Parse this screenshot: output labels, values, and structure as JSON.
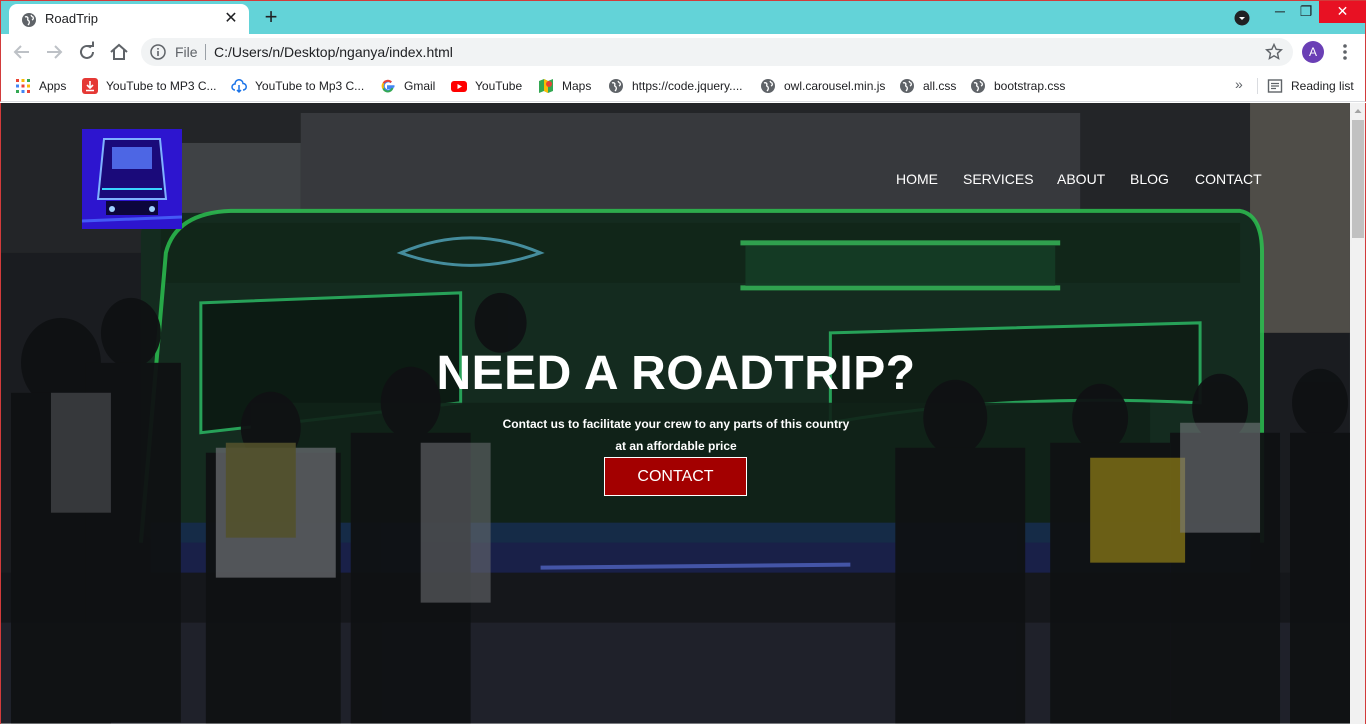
{
  "browser": {
    "tab": {
      "title": "RoadTrip"
    },
    "new_tab_symbol": "+",
    "omnibox": {
      "scheme_label": "File",
      "url": "C:/Users/n/Desktop/nganya/index.html"
    },
    "profile_initial": "A",
    "bookmarks": [
      {
        "label": "Apps",
        "icon": "apps-grid-icon"
      },
      {
        "label": "YouTube to MP3 C...",
        "icon": "download-icon"
      },
      {
        "label": "YouTube to Mp3 C...",
        "icon": "cloud-download-icon"
      },
      {
        "label": "Gmail",
        "icon": "google-icon"
      },
      {
        "label": "YouTube",
        "icon": "youtube-icon"
      },
      {
        "label": "Maps",
        "icon": "maps-icon"
      },
      {
        "label": "https://code.jquery....",
        "icon": "globe-icon"
      },
      {
        "label": "owl.carousel.min.js",
        "icon": "globe-icon"
      },
      {
        "label": "all.css",
        "icon": "globe-icon"
      },
      {
        "label": "bootstrap.css",
        "icon": "globe-icon"
      }
    ],
    "bookmarks_overflow": "»",
    "reading_list": "Reading list"
  },
  "page": {
    "nav": [
      "HOME",
      "SERVICES",
      "ABOUT",
      "BLOG",
      "CONTACT"
    ],
    "hero": {
      "headline": "NEED A ROADTRIP?",
      "subline_1": "Contact us to facilitate your crew to any parts of this country",
      "subline_2": "at an affordable price",
      "cta": "CONTACT"
    }
  },
  "colors": {
    "tabstrip": "#63d3d8",
    "cta": "#a30000",
    "overlay": "#1c1e22",
    "neon_green": "#39ff6a",
    "neon_blue": "#2a4dff"
  }
}
